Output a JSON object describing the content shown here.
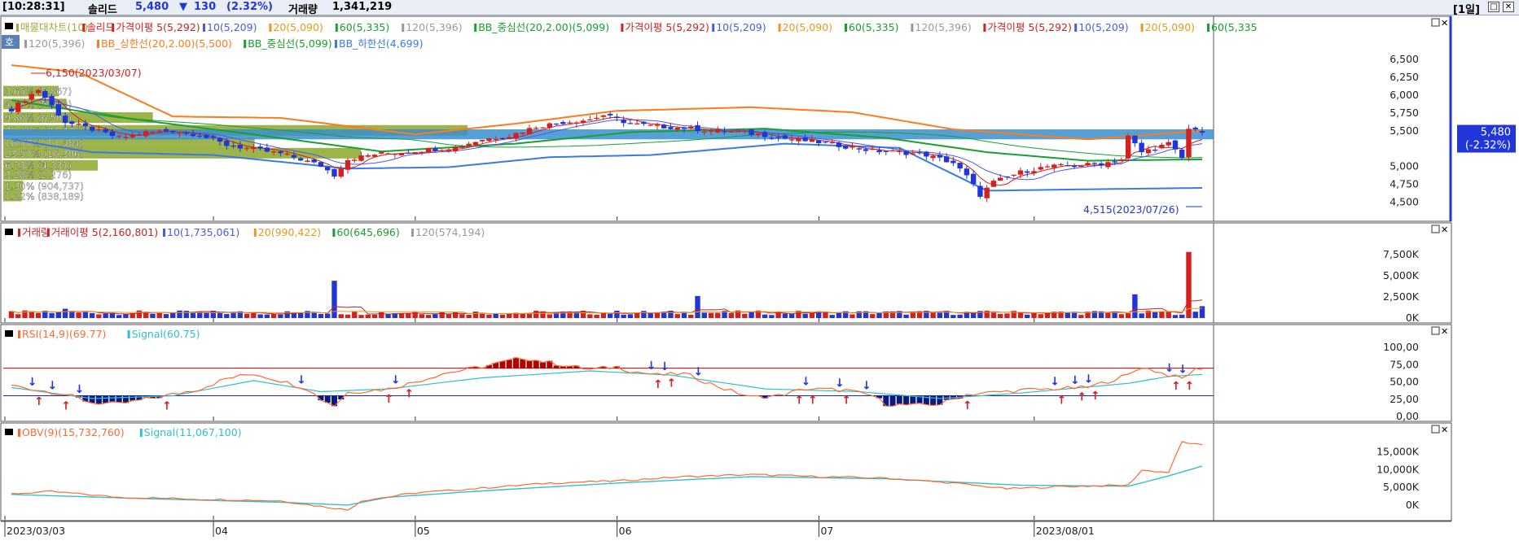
{
  "header": {
    "time": "[10:28:31]",
    "name": "솔리드",
    "price": "5,480",
    "change_arrow": "▼",
    "change": "130",
    "change_pct": "(2.32%)",
    "volume_label": "거래량",
    "volume": "1,341,219",
    "period": "[1일]"
  },
  "colors": {
    "up": "#d32020",
    "down": "#2036d8",
    "ma5": "#d02020",
    "ma10": "#4a5ae8",
    "ma20": "#e89a18",
    "ma60": "#18a030",
    "ma120": "#9a9a9a",
    "bb_upper": "#ff7a1a",
    "bb_mid": "#18a030",
    "bb_lower": "#3a7ae8",
    "profile": "#98b040",
    "band": "#3a8fd0",
    "rsi": "#ff6a30",
    "signal": "#30c0d0"
  },
  "panels": {
    "price": {
      "legend_row1": [
        {
          "text": "매물대차트(10)",
          "color": "#98b040"
        },
        {
          "text": "솔리드",
          "color": "#d32020"
        },
        {
          "text": "가격이평 5(5,292)",
          "color": "#d02020"
        },
        {
          "text": "10(5,209)",
          "color": "#4a5ae8"
        },
        {
          "text": "20(5,090)",
          "color": "#e89a18"
        },
        {
          "text": "60(5,335)",
          "color": "#18a030"
        },
        {
          "text": "120(5,396)",
          "color": "#9a9a9a"
        },
        {
          "text": "BB_중심선(20,2.00)(5,099)",
          "color": "#18a030"
        },
        {
          "text": "가격이평 5(5,292)",
          "color": "#d02020"
        },
        {
          "text": "10(5,209)",
          "color": "#4a5ae8"
        },
        {
          "text": "20(5,090)",
          "color": "#e89a18"
        },
        {
          "text": "60(5,335)",
          "color": "#18a030"
        },
        {
          "text": "120(5,396)",
          "color": "#9a9a9a"
        },
        {
          "text": "가격이평 5(5,292)",
          "color": "#d02020"
        },
        {
          "text": "10(5,209)",
          "color": "#4a5ae8"
        },
        {
          "text": "20(5,090)",
          "color": "#e89a18"
        },
        {
          "text": "60(5,335",
          "color": "#18a030"
        }
      ],
      "legend_row2": [
        {
          "text": "120(5,396)",
          "color": "#9a9a9a"
        },
        {
          "text": "BB_상한선(20,2.00)(5,500)",
          "color": "#ff7a1a"
        },
        {
          "text": "BB_중심선(5,099)",
          "color": "#18a030"
        },
        {
          "text": "BB_하한선(4,699)",
          "color": "#3a7ae8"
        }
      ],
      "side_tag": "호",
      "high_label": "6,150(2023/03/07)",
      "low_label": "4,515(2023/07/26)",
      "current_price": "5,480",
      "current_pct": "(-2.32%)"
    },
    "volume": {
      "legend": [
        {
          "text": "거래량",
          "color": "#d32020"
        },
        {
          "text": "거래이평 5(2,160,801)",
          "color": "#d02020"
        },
        {
          "text": "10(1,735,061)",
          "color": "#4a5ae8"
        },
        {
          "text": "20(990,422)",
          "color": "#e89a18"
        },
        {
          "text": "60(645,696)",
          "color": "#18a030"
        },
        {
          "text": "120(574,194)",
          "color": "#9a9a9a"
        }
      ]
    },
    "rsi": {
      "legend": [
        {
          "text": "RSI(14,9)(69.77)",
          "color": "#ff6a30"
        },
        {
          "text": "Signal(60.75)",
          "color": "#30c0d0"
        }
      ]
    },
    "obv": {
      "legend": [
        {
          "text": "OBV(9)(15,732,760)",
          "color": "#ff6a30"
        },
        {
          "text": "Signal(11,067,100)",
          "color": "#30c0d0"
        }
      ]
    }
  },
  "chart_data": [
    {
      "type": "candlestick",
      "title": "솔리드",
      "x_ticks": [
        "2023/03/03",
        "04",
        "05",
        "06",
        "07",
        "2023/08/01"
      ],
      "ylim": [
        4300,
        6900
      ],
      "y_ticks": [
        "6,500",
        "6,250",
        "6,000",
        "5,750",
        "5,500",
        "5,000",
        "4,750",
        "4,500"
      ],
      "close_anchors": [
        [
          0,
          5800
        ],
        [
          4,
          6080
        ],
        [
          8,
          5620
        ],
        [
          12,
          5520
        ],
        [
          16,
          5400
        ],
        [
          20,
          5480
        ],
        [
          24,
          5500
        ],
        [
          28,
          5440
        ],
        [
          32,
          5300
        ],
        [
          36,
          5240
        ],
        [
          40,
          5180
        ],
        [
          43,
          5100
        ],
        [
          46,
          5010
        ],
        [
          48,
          4880
        ],
        [
          50,
          5100
        ],
        [
          54,
          5170
        ],
        [
          58,
          5200
        ],
        [
          62,
          5240
        ],
        [
          66,
          5270
        ],
        [
          70,
          5380
        ],
        [
          74,
          5430
        ],
        [
          78,
          5560
        ],
        [
          82,
          5620
        ],
        [
          86,
          5660
        ],
        [
          88,
          5720
        ],
        [
          92,
          5600
        ],
        [
          96,
          5560
        ],
        [
          100,
          5540
        ],
        [
          104,
          5500
        ],
        [
          108,
          5480
        ],
        [
          112,
          5440
        ],
        [
          116,
          5380
        ],
        [
          120,
          5340
        ],
        [
          124,
          5280
        ],
        [
          128,
          5220
        ],
        [
          132,
          5200
        ],
        [
          136,
          5160
        ],
        [
          140,
          5050
        ],
        [
          142,
          4860
        ],
        [
          144,
          4600
        ],
        [
          146,
          4780
        ],
        [
          150,
          4920
        ],
        [
          154,
          5000
        ],
        [
          158,
          5010
        ],
        [
          162,
          5040
        ],
        [
          165,
          5100
        ],
        [
          166,
          5420
        ],
        [
          168,
          5200
        ],
        [
          170,
          5260
        ],
        [
          172,
          5320
        ],
        [
          174,
          5120
        ],
        [
          175,
          5520
        ],
        [
          176,
          5540
        ],
        [
          177,
          5480
        ]
      ],
      "bb_upper_anchors": [
        [
          0,
          6420
        ],
        [
          10,
          6320
        ],
        [
          24,
          5700
        ],
        [
          40,
          5680
        ],
        [
          60,
          5450
        ],
        [
          75,
          5600
        ],
        [
          90,
          5780
        ],
        [
          110,
          5830
        ],
        [
          125,
          5760
        ],
        [
          140,
          5520
        ],
        [
          160,
          5380
        ],
        [
          177,
          5500
        ]
      ],
      "bb_mid_anchors": [
        [
          0,
          5930
        ],
        [
          15,
          5700
        ],
        [
          35,
          5460
        ],
        [
          55,
          5210
        ],
        [
          75,
          5320
        ],
        [
          92,
          5480
        ],
        [
          112,
          5530
        ],
        [
          130,
          5400
        ],
        [
          145,
          5200
        ],
        [
          160,
          5080
        ],
        [
          177,
          5099
        ]
      ],
      "bb_lower_anchors": [
        [
          0,
          5380
        ],
        [
          12,
          5200
        ],
        [
          30,
          5160
        ],
        [
          50,
          4970
        ],
        [
          65,
          4990
        ],
        [
          80,
          5130
        ],
        [
          95,
          5160
        ],
        [
          115,
          5320
        ],
        [
          132,
          5260
        ],
        [
          145,
          4660
        ],
        [
          160,
          4680
        ],
        [
          177,
          4699
        ]
      ],
      "volume_profile": [
        {
          "label": "3.65% (5,867)",
          "price": 6050,
          "pct": 3.65
        },
        {
          "label": "4.18% (5,680)",
          "price": 5870,
          "pct": 4.18
        },
        {
          "label": "9.86% (6,506)",
          "price": 5680,
          "pct": 9.86
        },
        {
          "label": "30.60% (21,226)",
          "price": 5500,
          "pct": 30.6
        },
        {
          "label": "16.57% (11,484)",
          "price": 5320,
          "pct": 16.57
        },
        {
          "label": "23.57% (16,306)",
          "price": 5180,
          "pct": 23.57
        },
        {
          "label": "6.23% (4,331)",
          "price": 5010,
          "pct": 6.23
        },
        {
          "label": "3.28% (2,276)",
          "price": 4880,
          "pct": 3.28
        },
        {
          "label": "1.30% (904,737)",
          "price": 4720,
          "pct": 1.3
        },
        {
          "label": "1.22% (838,189)",
          "price": 4580,
          "pct": 1.22
        }
      ],
      "band_range": [
        5380,
        5520
      ]
    },
    {
      "type": "bar",
      "title": "거래량",
      "ylim": [
        0,
        9500
      ],
      "y_ticks": [
        "7,500K",
        "5,000K",
        "2,500K",
        "0K"
      ],
      "spikes": [
        [
          8,
          1100
        ],
        [
          48,
          4400
        ],
        [
          60,
          700
        ],
        [
          102,
          2600
        ],
        [
          167,
          2800
        ],
        [
          170,
          700
        ],
        [
          175,
          7800
        ],
        [
          177,
          1400
        ]
      ],
      "base_value": 600
    },
    {
      "type": "line",
      "title": "RSI",
      "ylim": [
        0,
        112
      ],
      "y_ticks": [
        "100,00",
        "75,00",
        "50,00",
        "25,00",
        "0,00"
      ],
      "levels": [
        70,
        30
      ],
      "rsi_anchors": [
        [
          0,
          45
        ],
        [
          8,
          32
        ],
        [
          12,
          20
        ],
        [
          16,
          18
        ],
        [
          20,
          25
        ],
        [
          24,
          32
        ],
        [
          28,
          40
        ],
        [
          32,
          55
        ],
        [
          36,
          62
        ],
        [
          40,
          52
        ],
        [
          44,
          40
        ],
        [
          46,
          25
        ],
        [
          48,
          16
        ],
        [
          50,
          35
        ],
        [
          56,
          40
        ],
        [
          60,
          50
        ],
        [
          64,
          62
        ],
        [
          70,
          72
        ],
        [
          76,
          85
        ],
        [
          80,
          78
        ],
        [
          86,
          68
        ],
        [
          90,
          72
        ],
        [
          92,
          66
        ],
        [
          96,
          60
        ],
        [
          100,
          62
        ],
        [
          106,
          40
        ],
        [
          110,
          28
        ],
        [
          114,
          30
        ],
        [
          118,
          40
        ],
        [
          124,
          38
        ],
        [
          128,
          30
        ],
        [
          130,
          18
        ],
        [
          134,
          16
        ],
        [
          138,
          18
        ],
        [
          142,
          32
        ],
        [
          150,
          38
        ],
        [
          160,
          42
        ],
        [
          166,
          60
        ],
        [
          168,
          72
        ],
        [
          172,
          60
        ],
        [
          174,
          55
        ],
        [
          176,
          68
        ],
        [
          177,
          70
        ]
      ],
      "signal_anchors": [
        [
          0,
          42
        ],
        [
          12,
          26
        ],
        [
          24,
          30
        ],
        [
          36,
          52
        ],
        [
          46,
          36
        ],
        [
          56,
          40
        ],
        [
          70,
          56
        ],
        [
          86,
          66
        ],
        [
          98,
          60
        ],
        [
          112,
          40
        ],
        [
          126,
          36
        ],
        [
          138,
          26
        ],
        [
          150,
          34
        ],
        [
          166,
          48
        ],
        [
          172,
          58
        ],
        [
          177,
          61
        ]
      ]
    },
    {
      "type": "line",
      "title": "OBV",
      "ylim": [
        -3000,
        19000
      ],
      "y_ticks": [
        "15,000K",
        "10,000K",
        "5,000K",
        "0K"
      ],
      "obv_anchors": [
        [
          0,
          3200
        ],
        [
          6,
          3800
        ],
        [
          16,
          2200
        ],
        [
          30,
          1600
        ],
        [
          40,
          1200
        ],
        [
          50,
          -1400
        ],
        [
          52,
          1200
        ],
        [
          60,
          3400
        ],
        [
          70,
          4800
        ],
        [
          80,
          6200
        ],
        [
          90,
          6800
        ],
        [
          100,
          8000
        ],
        [
          110,
          8600
        ],
        [
          120,
          8000
        ],
        [
          130,
          7600
        ],
        [
          140,
          6200
        ],
        [
          148,
          4600
        ],
        [
          156,
          5200
        ],
        [
          166,
          5600
        ],
        [
          168,
          9800
        ],
        [
          172,
          9200
        ],
        [
          174,
          17800
        ],
        [
          177,
          16800
        ]
      ],
      "signal_anchors": [
        [
          0,
          3000
        ],
        [
          20,
          1800
        ],
        [
          40,
          800
        ],
        [
          50,
          0
        ],
        [
          56,
          2200
        ],
        [
          70,
          4000
        ],
        [
          90,
          6200
        ],
        [
          110,
          8000
        ],
        [
          130,
          7400
        ],
        [
          150,
          5600
        ],
        [
          166,
          5300
        ],
        [
          172,
          8200
        ],
        [
          177,
          11000
        ]
      ]
    }
  ]
}
